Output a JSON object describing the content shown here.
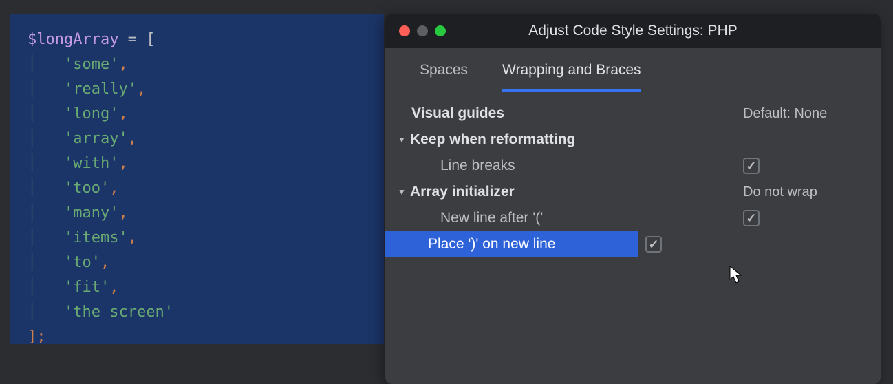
{
  "editor": {
    "variable": "$longArray",
    "assign": " = [",
    "items": [
      "some",
      "really",
      "long",
      "array",
      "with",
      "too",
      "many",
      "items",
      "to",
      "fit",
      "the screen"
    ],
    "close": "];"
  },
  "dialog": {
    "title": "Adjust Code Style Settings: PHP",
    "tabs": {
      "spaces": "Spaces",
      "wrapping": "Wrapping and Braces"
    },
    "rows": {
      "visual_guides": {
        "label": "Visual guides",
        "value": "Default: None"
      },
      "keep_reformatting": {
        "label": "Keep when reformatting"
      },
      "line_breaks": {
        "label": "Line breaks"
      },
      "array_init": {
        "label": "Array initializer",
        "value": "Do not wrap"
      },
      "new_line_after": {
        "label": "New line after '('"
      },
      "place_paren": {
        "label": "Place ')' on new line"
      }
    }
  }
}
